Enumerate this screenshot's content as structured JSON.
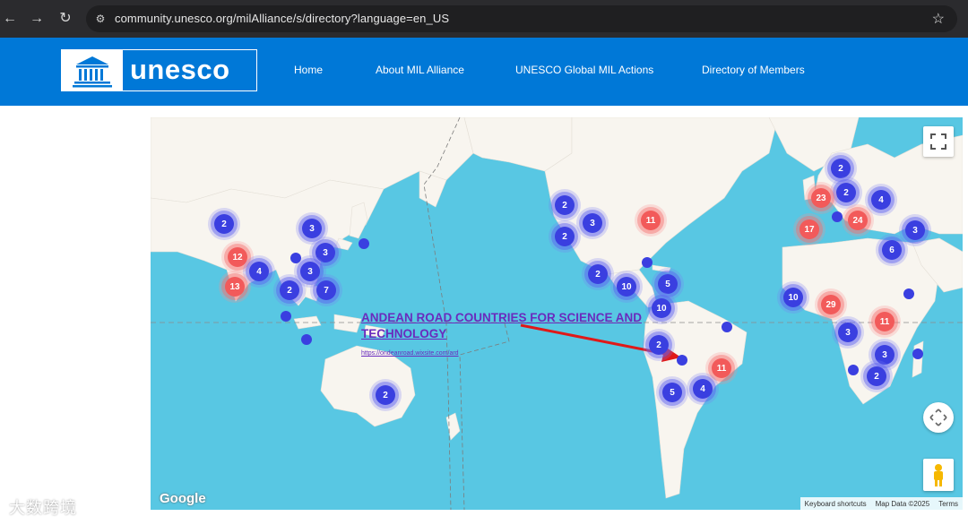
{
  "browser": {
    "url": "community.unesco.org/milAlliance/s/directory?language=en_US",
    "back_icon": "back-arrow-icon",
    "forward_icon": "forward-arrow-icon",
    "reload_icon": "reload-icon",
    "site_info_icon": "site-info-icon",
    "bookmark_icon": "star-icon"
  },
  "header": {
    "logo_text": "unesco",
    "nav": [
      "Home",
      "About MIL Alliance",
      "UNESCO Global MIL Actions",
      "Directory of Members"
    ],
    "bg_color": "#0078d7"
  },
  "map": {
    "annotation_title": "ANDEAN ROAD COUNTRIES FOR SCIENCE AND TECHNOLOGY",
    "annotation_link": "https://ondeanroad.wixsite.com/ard",
    "google_label": "Google",
    "attribution": [
      "Keyboard shortcuts",
      "Map Data ©2025",
      "Terms"
    ],
    "cluster_colors": {
      "blue": "#3a3fe0",
      "red": "#f25a5a"
    },
    "clusters": [
      {
        "label": "2",
        "color": "blue"
      },
      {
        "label": "3",
        "color": "blue"
      },
      {
        "label": "12",
        "color": "red"
      },
      {
        "label": "3",
        "color": "blue"
      },
      {
        "label": "4",
        "color": "blue"
      },
      {
        "label": "3",
        "color": "blue"
      },
      {
        "label": "13",
        "color": "red"
      },
      {
        "label": "2",
        "color": "blue"
      },
      {
        "label": "7",
        "color": "blue"
      },
      {
        "label": "2",
        "color": "blue"
      },
      {
        "label": "2",
        "color": "blue"
      },
      {
        "label": "3",
        "color": "blue"
      },
      {
        "label": "2",
        "color": "blue"
      },
      {
        "label": "11",
        "color": "red"
      },
      {
        "label": "2",
        "color": "blue"
      },
      {
        "label": "10",
        "color": "blue"
      },
      {
        "label": "5",
        "color": "blue"
      },
      {
        "label": "10",
        "color": "blue"
      },
      {
        "label": "2",
        "color": "blue"
      },
      {
        "label": "11",
        "color": "red"
      },
      {
        "label": "4",
        "color": "blue"
      },
      {
        "label": "5",
        "color": "blue"
      },
      {
        "label": "2",
        "color": "blue"
      },
      {
        "label": "2",
        "color": "blue"
      },
      {
        "label": "23",
        "color": "red"
      },
      {
        "label": "4",
        "color": "blue"
      },
      {
        "label": "24",
        "color": "red"
      },
      {
        "label": "17",
        "color": "red"
      },
      {
        "label": "3",
        "color": "blue"
      },
      {
        "label": "6",
        "color": "blue"
      },
      {
        "label": "10",
        "color": "blue"
      },
      {
        "label": "29",
        "color": "red"
      },
      {
        "label": "11",
        "color": "red"
      },
      {
        "label": "3",
        "color": "blue"
      },
      {
        "label": "3",
        "color": "blue"
      },
      {
        "label": "2",
        "color": "blue"
      }
    ],
    "controls": {
      "fullscreen_icon": "fullscreen-icon",
      "pan_icon": "pan-control-icon",
      "street_view_icon": "pegman-icon"
    }
  },
  "watermark": "大数跨境"
}
